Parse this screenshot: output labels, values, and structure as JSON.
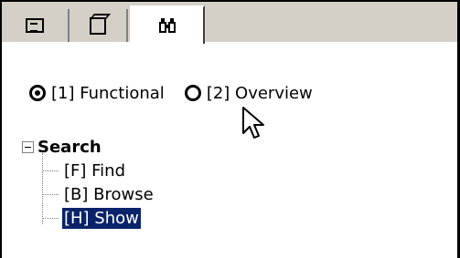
{
  "tabs": [
    {
      "icon": "document-icon"
    },
    {
      "icon": "cube-icon"
    },
    {
      "icon": "binoculars-icon",
      "glyph": "👓"
    }
  ],
  "view_options": {
    "options": [
      {
        "label": "[1] Functional",
        "checked": true
      },
      {
        "label": "[2] Overview",
        "checked": false
      }
    ]
  },
  "tree": {
    "root_label": "Search",
    "items": [
      {
        "label": "[F] Find"
      },
      {
        "label": "[B] Browse"
      },
      {
        "label": "[H] Show"
      }
    ]
  }
}
